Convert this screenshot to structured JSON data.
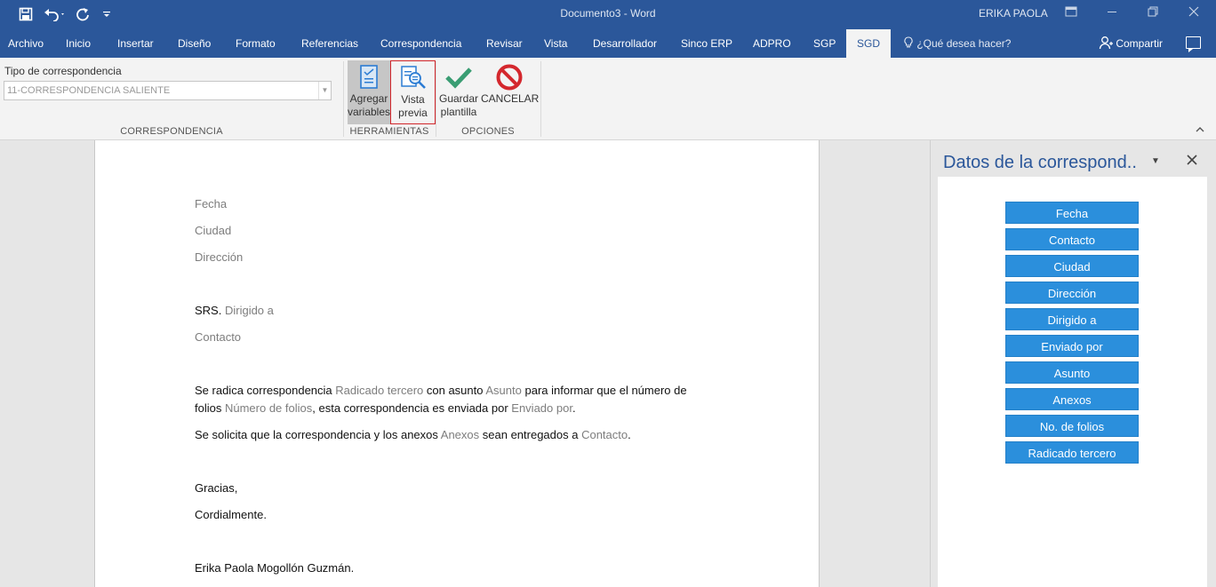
{
  "titlebar": {
    "doc_title": "Documento3  -  Word",
    "user": "ERIKA PAOLA",
    "color": "#2b579a"
  },
  "quick_access": {
    "save_icon": "save-icon",
    "undo_icon": "undo-icon",
    "redo_icon": "repeat-icon",
    "customize_icon": "customize-quick-access-icon"
  },
  "menu": {
    "tabs": [
      "Archivo",
      "Inicio",
      "Insertar",
      "Diseño",
      "Formato",
      "Referencias",
      "Correspondencia",
      "Revisar",
      "Vista",
      "Desarrollador",
      "Sinco ERP",
      "ADPRO",
      "SGP",
      "SGD"
    ],
    "active_tab": "SGD",
    "tellme": "¿Qué desea hacer?",
    "share": "Compartir"
  },
  "ribbon": {
    "tipo_label": "Tipo de correspondencia",
    "tipo_value": "11-CORRESPONDENCIA SALIENTE",
    "groups": [
      "CORRESPONDENCIA",
      "HERRAMIENTAS",
      "OPCIONES"
    ],
    "buttons": {
      "agregar_1": "Agregar",
      "agregar_2": "variables",
      "vista_1": "Vista",
      "vista_2": "previa",
      "guardar_1": "Guardar",
      "guardar_2": "plantilla",
      "cancelar": "CANCELAR"
    }
  },
  "document": {
    "fecha": "Fecha",
    "ciudad": "Ciudad",
    "direccion": "Dirección",
    "srs": "SRS. ",
    "dirigido": "Dirigido a",
    "contacto": "Contacto",
    "p1_a": "Se radica correspondencia ",
    "p1_radicado": "Radicado tercero",
    "p1_b": " con asunto ",
    "p1_asunto": "Asunto",
    "p1_c": " para informar que el número de",
    "p1_d": "folios ",
    "p1_folios": "Número de folios",
    "p1_e": ", esta correspondencia es enviada por ",
    "p1_enviado": "Enviado por",
    "p1_f": ".",
    "p2_a": "Se solicita que la correspondencia y los anexos ",
    "p2_anexos": "Anexos",
    "p2_b": " sean entregados a ",
    "p2_contacto": "Contacto",
    "p2_c": ".",
    "gracias": "Gracias,",
    "cordial": "Cordialmente.",
    "firma": "Erika Paola Mogollón Guzmán."
  },
  "pane": {
    "title": "Datos de la correspond..",
    "buttons": [
      "Fecha",
      "Contacto",
      "Ciudad",
      "Dirección",
      "Dirigido a",
      "Enviado por",
      "Asunto",
      "Anexos",
      "No. de folios",
      "Radicado tercero"
    ],
    "button_color": "#2b8fdc"
  }
}
